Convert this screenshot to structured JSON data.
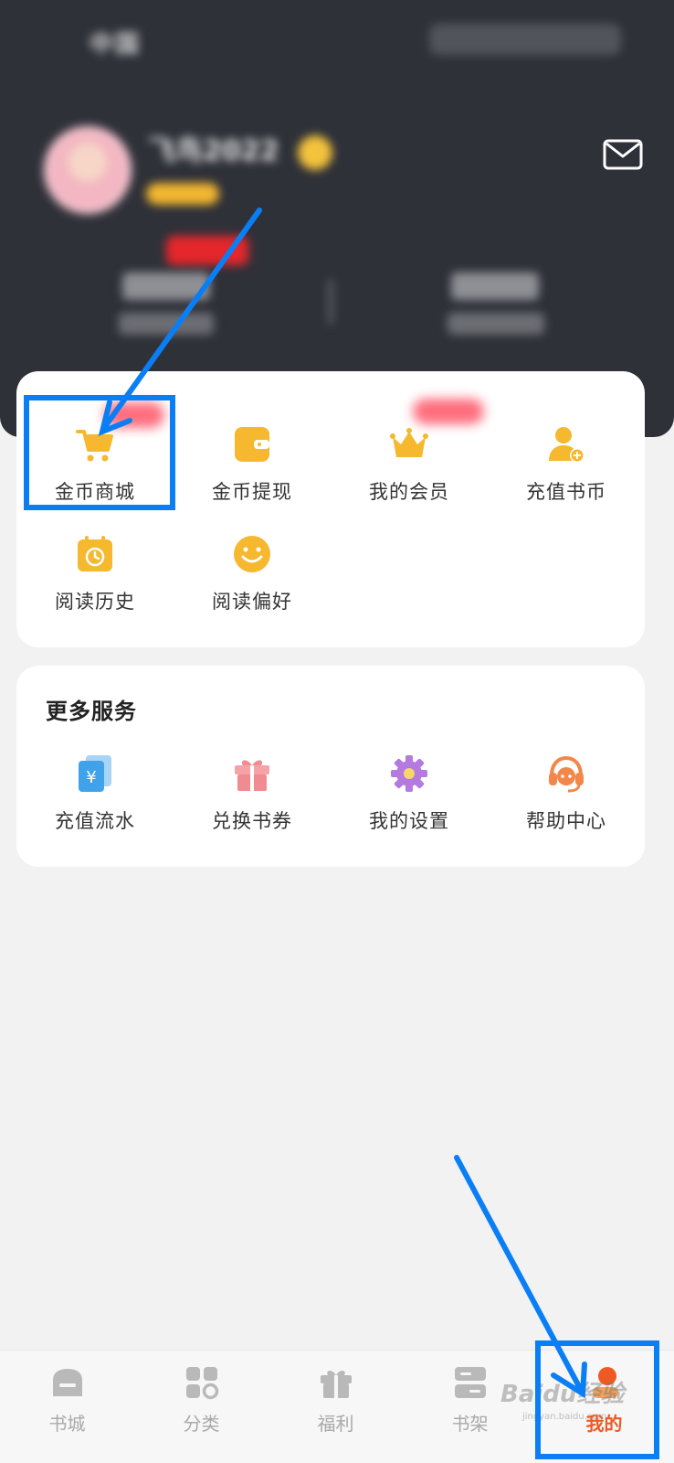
{
  "header": {
    "status_left": "中国",
    "user_name": "飞鸟2022"
  },
  "functions": [
    {
      "label": "金币商城",
      "icon": "cart-icon"
    },
    {
      "label": "金币提现",
      "icon": "wallet-icon"
    },
    {
      "label": "我的会员",
      "icon": "crown-icon"
    },
    {
      "label": "充值书币",
      "icon": "user-add-icon"
    },
    {
      "label": "阅读历史",
      "icon": "history-calendar-icon"
    },
    {
      "label": "阅读偏好",
      "icon": "smile-icon"
    }
  ],
  "more_services": {
    "title": "更多服务",
    "items": [
      {
        "label": "充值流水",
        "icon": "yuan-bill-icon"
      },
      {
        "label": "兑换书券",
        "icon": "gift-box-icon"
      },
      {
        "label": "我的设置",
        "icon": "settings-gear-icon"
      },
      {
        "label": "帮助中心",
        "icon": "headset-icon"
      }
    ]
  },
  "bottom_nav": [
    {
      "label": "书城",
      "icon": "bookstore-icon"
    },
    {
      "label": "分类",
      "icon": "category-icon"
    },
    {
      "label": "福利",
      "icon": "gift-icon"
    },
    {
      "label": "书架",
      "icon": "bookshelf-icon"
    },
    {
      "label": "我的",
      "icon": "profile-icon",
      "active": true
    }
  ],
  "watermark": {
    "text": "Baidu经验",
    "sub": "jingyan.baidu.com"
  },
  "colors": {
    "header_bg": "#2f3139",
    "accent_yellow": "#f5b82e",
    "active_nav": "#ee5a24",
    "highlight_blue": "#0a7ff5"
  }
}
